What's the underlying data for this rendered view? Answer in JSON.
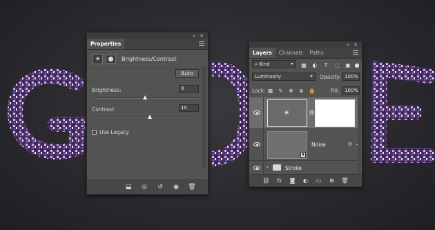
{
  "canvas_letters": [
    "G",
    "O",
    "E"
  ],
  "properties_panel": {
    "tab_label": "Properties",
    "adjustment_title": "Brightness/Contrast",
    "auto_label": "Auto",
    "brightness_label": "Brightness:",
    "brightness_value": "0",
    "contrast_label": "Contrast:",
    "contrast_value": "10",
    "use_legacy_label": "Use Legacy"
  },
  "layers_panel": {
    "tabs": [
      "Layers",
      "Channels",
      "Paths"
    ],
    "filter_kind": "Kind",
    "blend_mode": "Luminosity",
    "opacity_label": "Opacity:",
    "opacity_value": "100%",
    "lock_label": "Lock:",
    "fill_label": "Fill:",
    "fill_value": "100%",
    "layers": [
      {
        "name": "",
        "type": "adjustment"
      },
      {
        "name": "Noise",
        "type": "smart-object"
      },
      {
        "name": "Stroke",
        "type": "group"
      }
    ]
  },
  "colors": {
    "panel_bg": "#535353",
    "selected_layer": "#6e6e6e",
    "glitter_purple": "#5a3d7a"
  }
}
